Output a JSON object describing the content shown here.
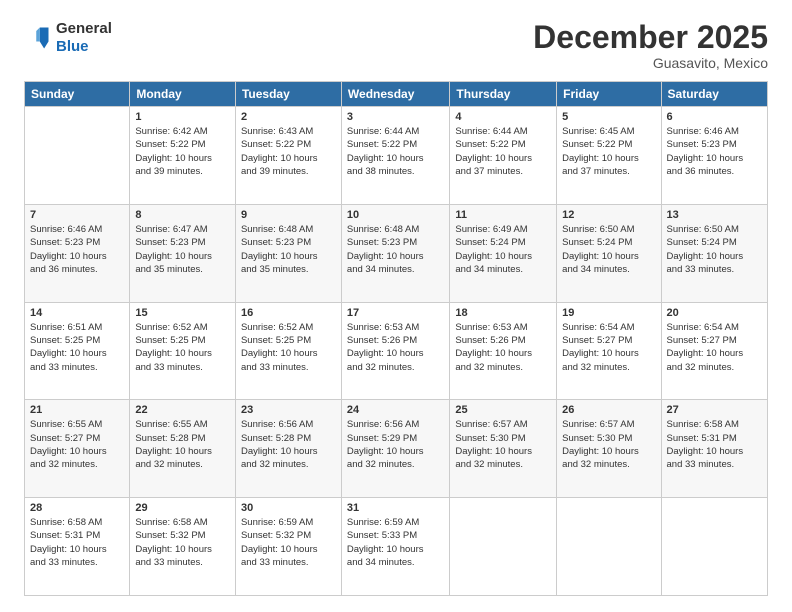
{
  "header": {
    "logo_general": "General",
    "logo_blue": "Blue",
    "month_title": "December 2025",
    "location": "Guasavito, Mexico"
  },
  "weekdays": [
    "Sunday",
    "Monday",
    "Tuesday",
    "Wednesday",
    "Thursday",
    "Friday",
    "Saturday"
  ],
  "weeks": [
    [
      {
        "day": "",
        "info": ""
      },
      {
        "day": "1",
        "info": "Sunrise: 6:42 AM\nSunset: 5:22 PM\nDaylight: 10 hours\nand 39 minutes."
      },
      {
        "day": "2",
        "info": "Sunrise: 6:43 AM\nSunset: 5:22 PM\nDaylight: 10 hours\nand 39 minutes."
      },
      {
        "day": "3",
        "info": "Sunrise: 6:44 AM\nSunset: 5:22 PM\nDaylight: 10 hours\nand 38 minutes."
      },
      {
        "day": "4",
        "info": "Sunrise: 6:44 AM\nSunset: 5:22 PM\nDaylight: 10 hours\nand 37 minutes."
      },
      {
        "day": "5",
        "info": "Sunrise: 6:45 AM\nSunset: 5:22 PM\nDaylight: 10 hours\nand 37 minutes."
      },
      {
        "day": "6",
        "info": "Sunrise: 6:46 AM\nSunset: 5:23 PM\nDaylight: 10 hours\nand 36 minutes."
      }
    ],
    [
      {
        "day": "7",
        "info": "Sunrise: 6:46 AM\nSunset: 5:23 PM\nDaylight: 10 hours\nand 36 minutes."
      },
      {
        "day": "8",
        "info": "Sunrise: 6:47 AM\nSunset: 5:23 PM\nDaylight: 10 hours\nand 35 minutes."
      },
      {
        "day": "9",
        "info": "Sunrise: 6:48 AM\nSunset: 5:23 PM\nDaylight: 10 hours\nand 35 minutes."
      },
      {
        "day": "10",
        "info": "Sunrise: 6:48 AM\nSunset: 5:23 PM\nDaylight: 10 hours\nand 34 minutes."
      },
      {
        "day": "11",
        "info": "Sunrise: 6:49 AM\nSunset: 5:24 PM\nDaylight: 10 hours\nand 34 minutes."
      },
      {
        "day": "12",
        "info": "Sunrise: 6:50 AM\nSunset: 5:24 PM\nDaylight: 10 hours\nand 34 minutes."
      },
      {
        "day": "13",
        "info": "Sunrise: 6:50 AM\nSunset: 5:24 PM\nDaylight: 10 hours\nand 33 minutes."
      }
    ],
    [
      {
        "day": "14",
        "info": "Sunrise: 6:51 AM\nSunset: 5:25 PM\nDaylight: 10 hours\nand 33 minutes."
      },
      {
        "day": "15",
        "info": "Sunrise: 6:52 AM\nSunset: 5:25 PM\nDaylight: 10 hours\nand 33 minutes."
      },
      {
        "day": "16",
        "info": "Sunrise: 6:52 AM\nSunset: 5:25 PM\nDaylight: 10 hours\nand 33 minutes."
      },
      {
        "day": "17",
        "info": "Sunrise: 6:53 AM\nSunset: 5:26 PM\nDaylight: 10 hours\nand 32 minutes."
      },
      {
        "day": "18",
        "info": "Sunrise: 6:53 AM\nSunset: 5:26 PM\nDaylight: 10 hours\nand 32 minutes."
      },
      {
        "day": "19",
        "info": "Sunrise: 6:54 AM\nSunset: 5:27 PM\nDaylight: 10 hours\nand 32 minutes."
      },
      {
        "day": "20",
        "info": "Sunrise: 6:54 AM\nSunset: 5:27 PM\nDaylight: 10 hours\nand 32 minutes."
      }
    ],
    [
      {
        "day": "21",
        "info": "Sunrise: 6:55 AM\nSunset: 5:27 PM\nDaylight: 10 hours\nand 32 minutes."
      },
      {
        "day": "22",
        "info": "Sunrise: 6:55 AM\nSunset: 5:28 PM\nDaylight: 10 hours\nand 32 minutes."
      },
      {
        "day": "23",
        "info": "Sunrise: 6:56 AM\nSunset: 5:28 PM\nDaylight: 10 hours\nand 32 minutes."
      },
      {
        "day": "24",
        "info": "Sunrise: 6:56 AM\nSunset: 5:29 PM\nDaylight: 10 hours\nand 32 minutes."
      },
      {
        "day": "25",
        "info": "Sunrise: 6:57 AM\nSunset: 5:30 PM\nDaylight: 10 hours\nand 32 minutes."
      },
      {
        "day": "26",
        "info": "Sunrise: 6:57 AM\nSunset: 5:30 PM\nDaylight: 10 hours\nand 32 minutes."
      },
      {
        "day": "27",
        "info": "Sunrise: 6:58 AM\nSunset: 5:31 PM\nDaylight: 10 hours\nand 33 minutes."
      }
    ],
    [
      {
        "day": "28",
        "info": "Sunrise: 6:58 AM\nSunset: 5:31 PM\nDaylight: 10 hours\nand 33 minutes."
      },
      {
        "day": "29",
        "info": "Sunrise: 6:58 AM\nSunset: 5:32 PM\nDaylight: 10 hours\nand 33 minutes."
      },
      {
        "day": "30",
        "info": "Sunrise: 6:59 AM\nSunset: 5:32 PM\nDaylight: 10 hours\nand 33 minutes."
      },
      {
        "day": "31",
        "info": "Sunrise: 6:59 AM\nSunset: 5:33 PM\nDaylight: 10 hours\nand 34 minutes."
      },
      {
        "day": "",
        "info": ""
      },
      {
        "day": "",
        "info": ""
      },
      {
        "day": "",
        "info": ""
      }
    ]
  ]
}
